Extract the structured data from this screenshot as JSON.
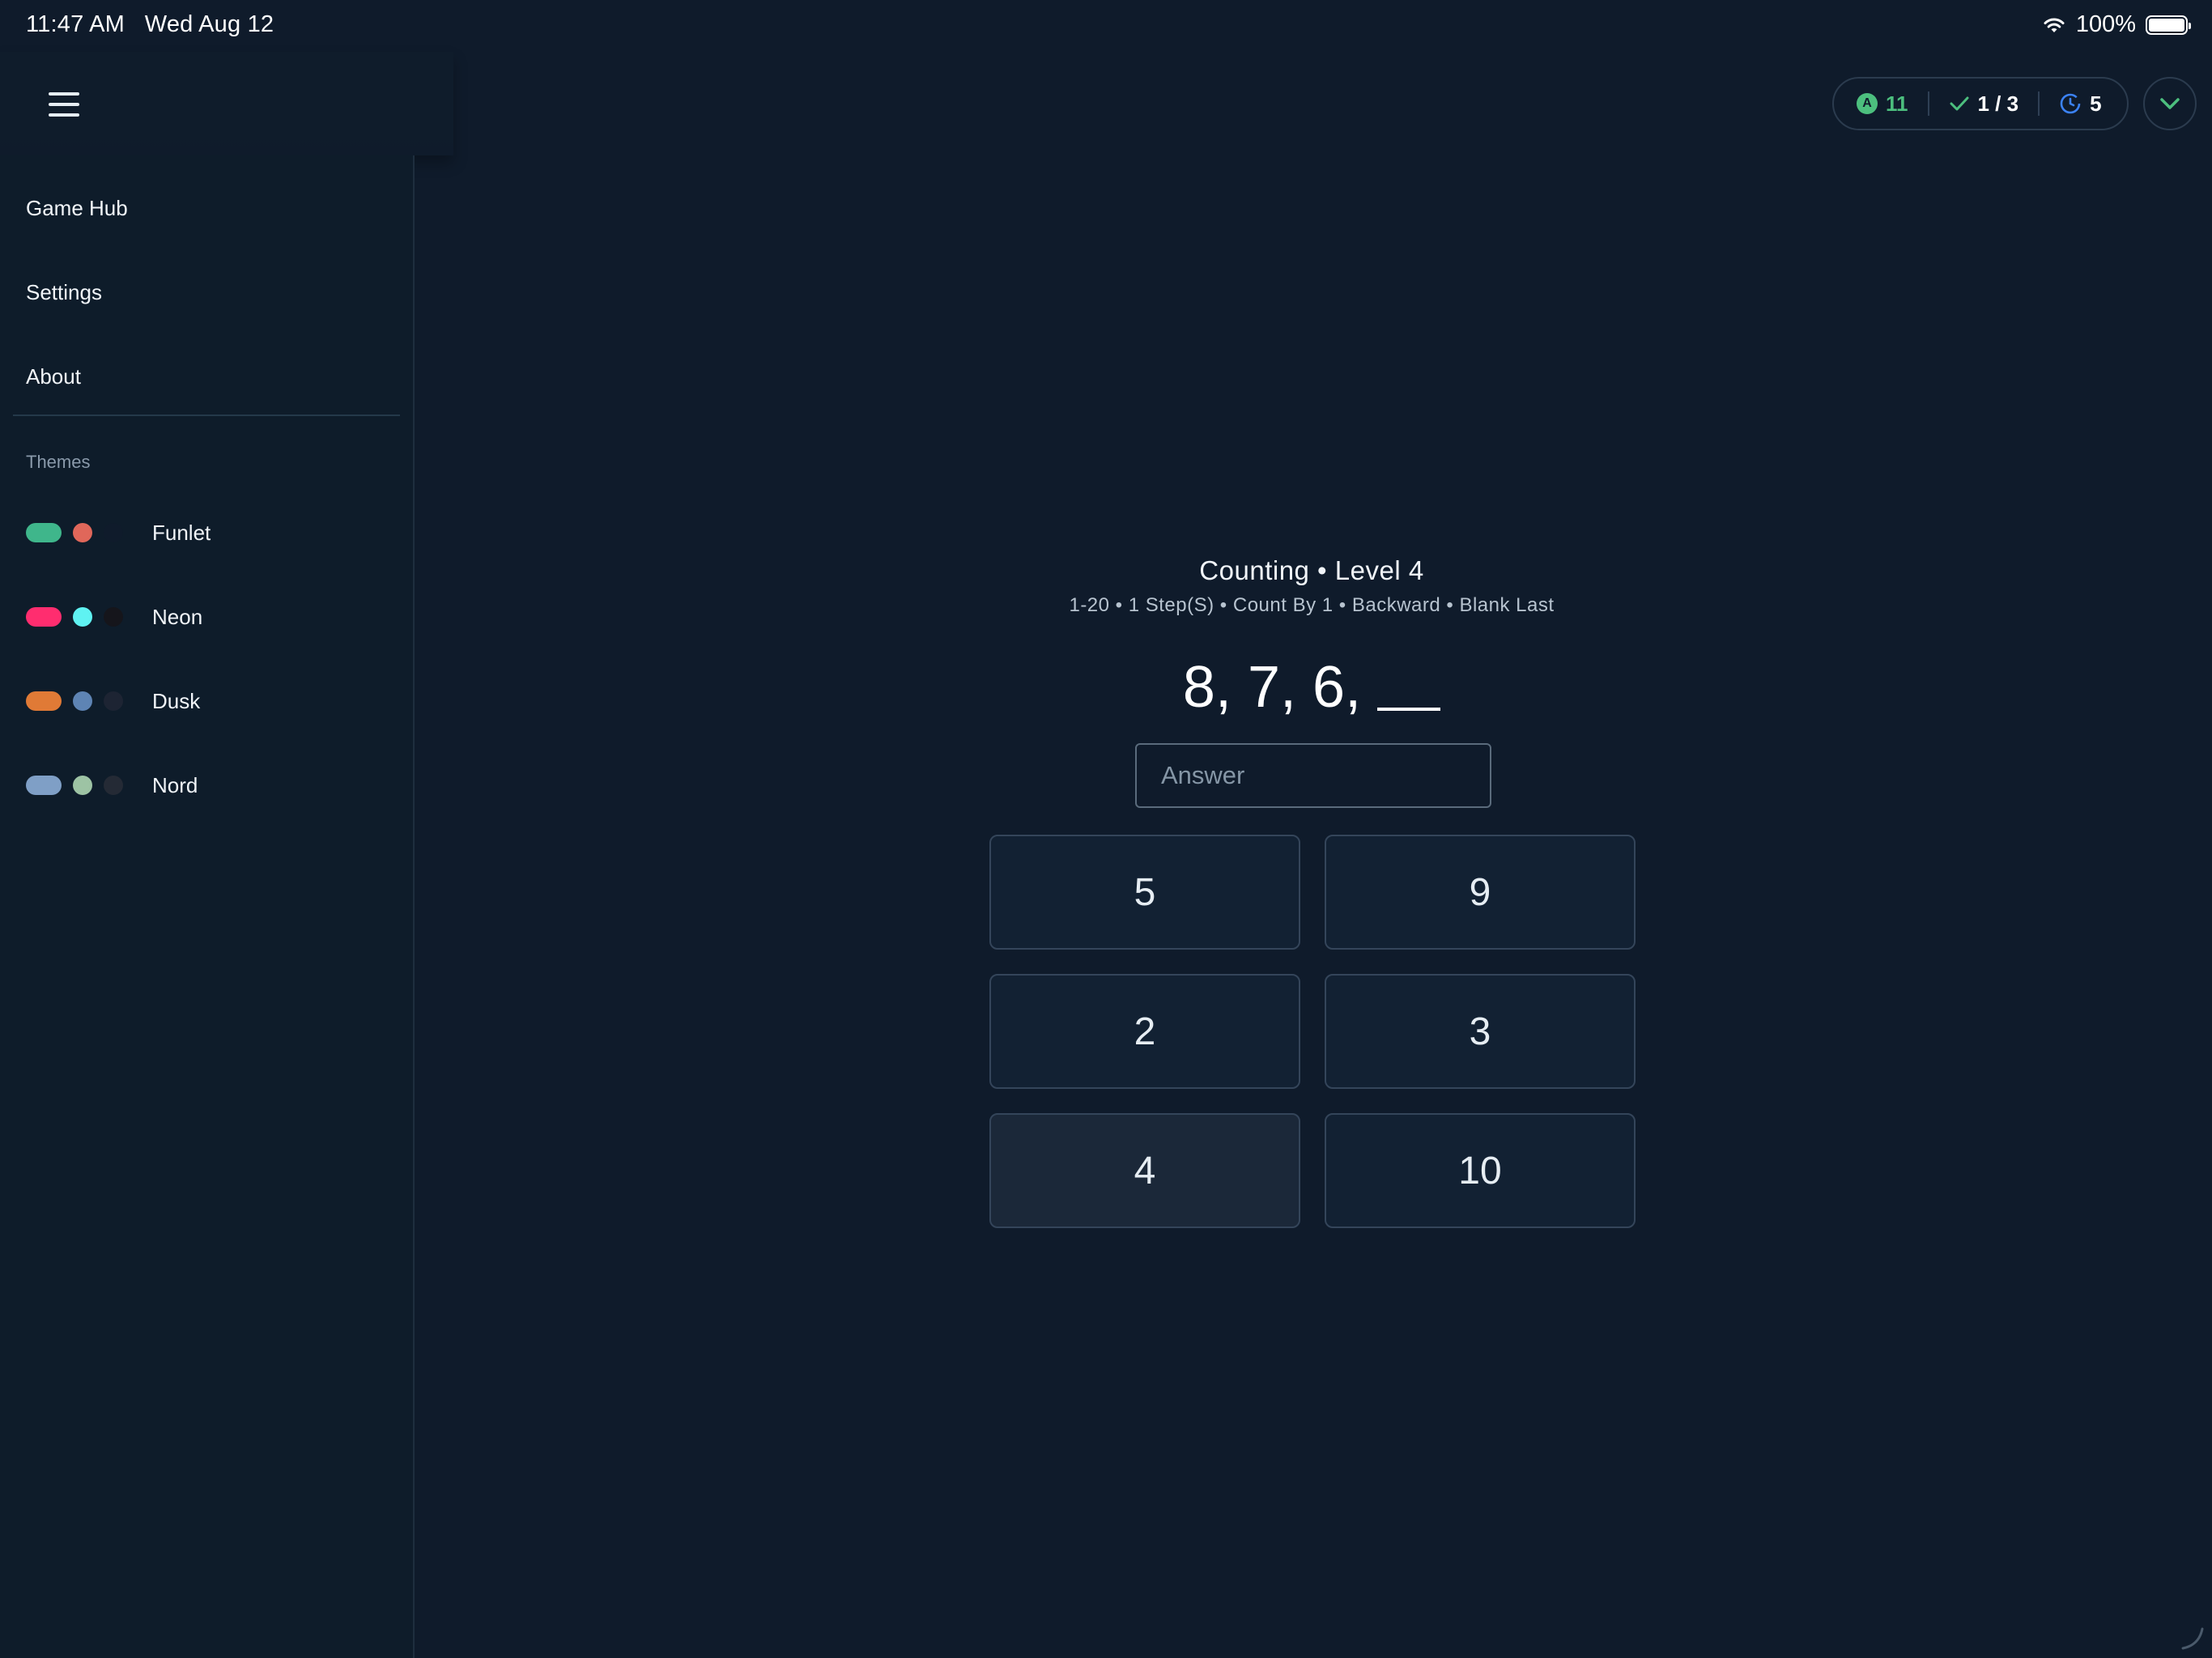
{
  "status_bar": {
    "time": "11:47 AM",
    "date": "Wed Aug 12",
    "battery": "100%"
  },
  "header": {
    "menu_icon": "hamburger-menu-icon",
    "stats": {
      "coins": "11",
      "progress": "1 / 3",
      "timer": "5",
      "coin_icon_letter": "A"
    },
    "collapse_icon": "chevron-down-icon",
    "colors": {
      "accent_green": "#4cbf7e",
      "timer_blue": "#3b82f6"
    }
  },
  "sidebar": {
    "items": [
      {
        "label": "Game Hub"
      },
      {
        "label": "Settings"
      },
      {
        "label": "About"
      }
    ],
    "themes_heading": "Themes",
    "themes": [
      {
        "label": "Funlet",
        "pill": "#3fb68b",
        "dot": "#e0675a",
        "dark": "#0f1b2b"
      },
      {
        "label": "Neon",
        "pill": "#ff2d6f",
        "dot": "#5ff2f2",
        "dark": "#15151b"
      },
      {
        "label": "Dusk",
        "pill": "#e07a36",
        "dot": "#5e84b4",
        "dark": "#1d2433"
      },
      {
        "label": "Nord",
        "pill": "#7f9fc6",
        "dot": "#9dc3a4",
        "dark": "#242a35"
      }
    ]
  },
  "game": {
    "title": "Counting • Level 4",
    "subtitle": "1-20 • 1 Step(S) • Count By 1 • Backward • Blank Last",
    "sequence": "8, 7, 6,",
    "answer_placeholder": "Answer",
    "choices": [
      "5",
      "9",
      "2",
      "3",
      "4",
      "10"
    ]
  }
}
